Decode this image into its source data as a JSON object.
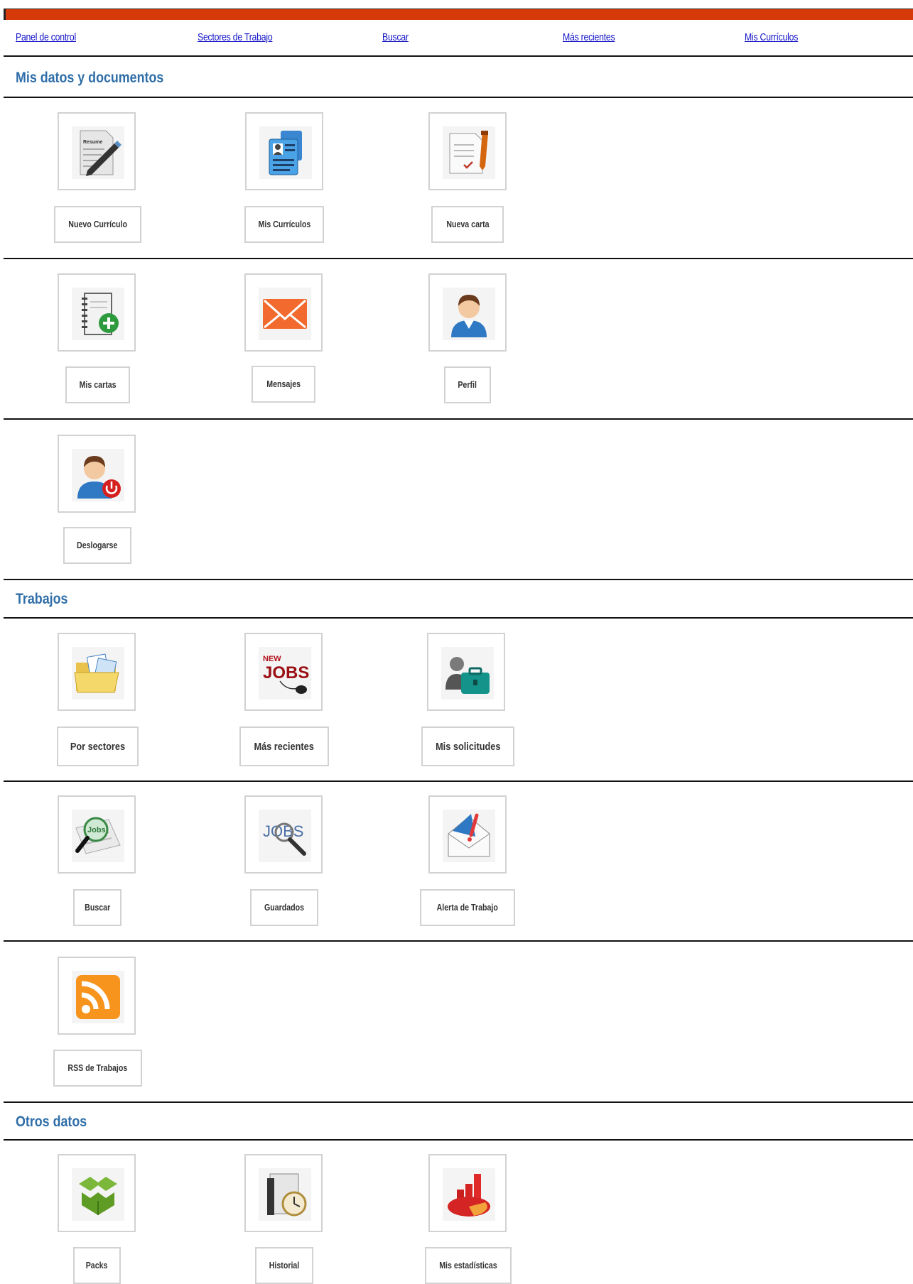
{
  "nav": {
    "panel": "Panel de control",
    "sectores": "Sectores de Trabajo",
    "buscar": "Buscar",
    "recientes": "Más recientes",
    "curriculos": "Mis Currículos"
  },
  "sections": {
    "datos": "Mis datos y documentos",
    "trabajos": "Trabajos",
    "otros": "Otros datos"
  },
  "items": {
    "nuevo_curriculo": "Nuevo Currículo",
    "mis_curriculos": "Mis Currículos",
    "nueva_carta": "Nueva carta",
    "mis_cartas": "Mis cartas",
    "mensajes": "Mensajes",
    "perfil": "Perfil",
    "deslogarse": "Deslogarse",
    "por_sectores": "Por sectores",
    "mas_recientes": "Más recientes",
    "mis_solicitudes": "Mis solicitudes",
    "buscar": "Buscar",
    "guardados": "Guardados",
    "alerta": "Alerta de Trabajo",
    "rss": "RSS de Trabajos",
    "packs": "Packs",
    "historial": "Historial",
    "estadisticas": "Mis estadísticas"
  },
  "icon_texts": {
    "resume_doc": "Resume",
    "new_jobs_new": "NEW",
    "new_jobs_jobs": "JOBS",
    "jobs_search": "JOBS",
    "newspaper_jobs": "Jobs"
  },
  "icons": {
    "nuevo_curriculo": "resume-pen-icon",
    "mis_curriculos": "id-cards-icon",
    "nueva_carta": "letter-pen-icon",
    "mis_cartas": "notebook-add-icon",
    "mensajes": "envelope-icon",
    "perfil": "user-icon",
    "deslogarse": "user-logout-icon",
    "por_sectores": "folder-documents-icon",
    "mas_recientes": "new-jobs-icon",
    "mis_solicitudes": "user-briefcase-icon",
    "buscar": "newspaper-magnifier-icon",
    "guardados": "jobs-magnifier-icon",
    "alerta": "alert-envelope-icon",
    "rss": "rss-icon",
    "packs": "box-icon",
    "historial": "history-folder-icon",
    "estadisticas": "statistics-chart-icon"
  },
  "colors": {
    "topbar": "#d63a08",
    "link": "#1414c8",
    "section_title": "#2f6ea8"
  }
}
